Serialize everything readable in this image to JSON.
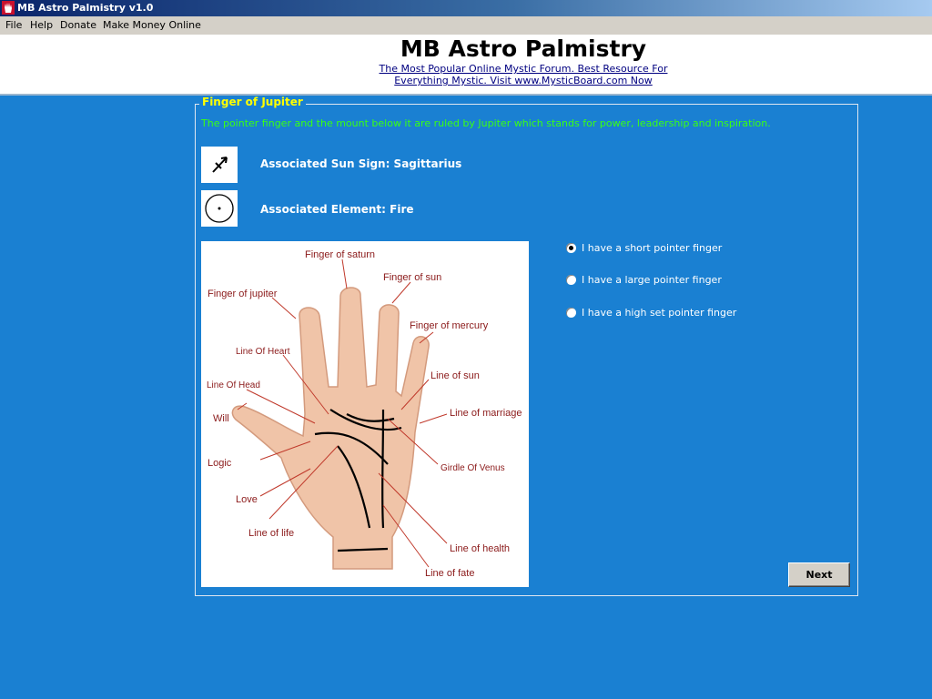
{
  "window": {
    "title": "MB Astro Palmistry v1.0"
  },
  "menu": [
    "File",
    "Help",
    "Donate",
    "Make Money Online"
  ],
  "header": {
    "title": "MB Astro Palmistry",
    "link_line1": "The Most Popular Online Mystic Forum. Best Resource For",
    "link_line2": "Everything Mystic. Visit www.MysticBoard.com Now"
  },
  "section": {
    "legend": "Finger of  Jupiter",
    "description": "The pointer finger and the mount below it are ruled by Jupiter which stands for power, leadership and inspiration.",
    "sun_sign": "Associated Sun Sign: Sagittarius",
    "element": "Associated Element: Fire",
    "sun_sign_icon": "sagittarius-arrow-icon",
    "element_icon": "fire-circle-dot-icon"
  },
  "hand_image": {
    "labels": {
      "saturn": "Finger of saturn",
      "sun": "Finger of sun",
      "jupiter": "Finger of jupiter",
      "mercury": "Finger of mercury",
      "heart": "Line Of Heart",
      "line_sun": "Line of sun",
      "head": "Line Of Head",
      "will": "Will",
      "marriage": "Line of marriage",
      "logic": "Logic",
      "venus": "Girdle Of Venus",
      "love": "Love",
      "life": "Line of life",
      "health": "Line of health",
      "fate": "Line of fate"
    }
  },
  "options": [
    {
      "label": "I have a short pointer finger",
      "selected": true
    },
    {
      "label": "I have a large pointer finger",
      "selected": false
    },
    {
      "label": "I have a high set pointer finger",
      "selected": false
    }
  ],
  "buttons": {
    "next": "Next"
  },
  "colors": {
    "background": "#1a80d2",
    "legend": "#ffff00",
    "description": "#39ff14"
  }
}
